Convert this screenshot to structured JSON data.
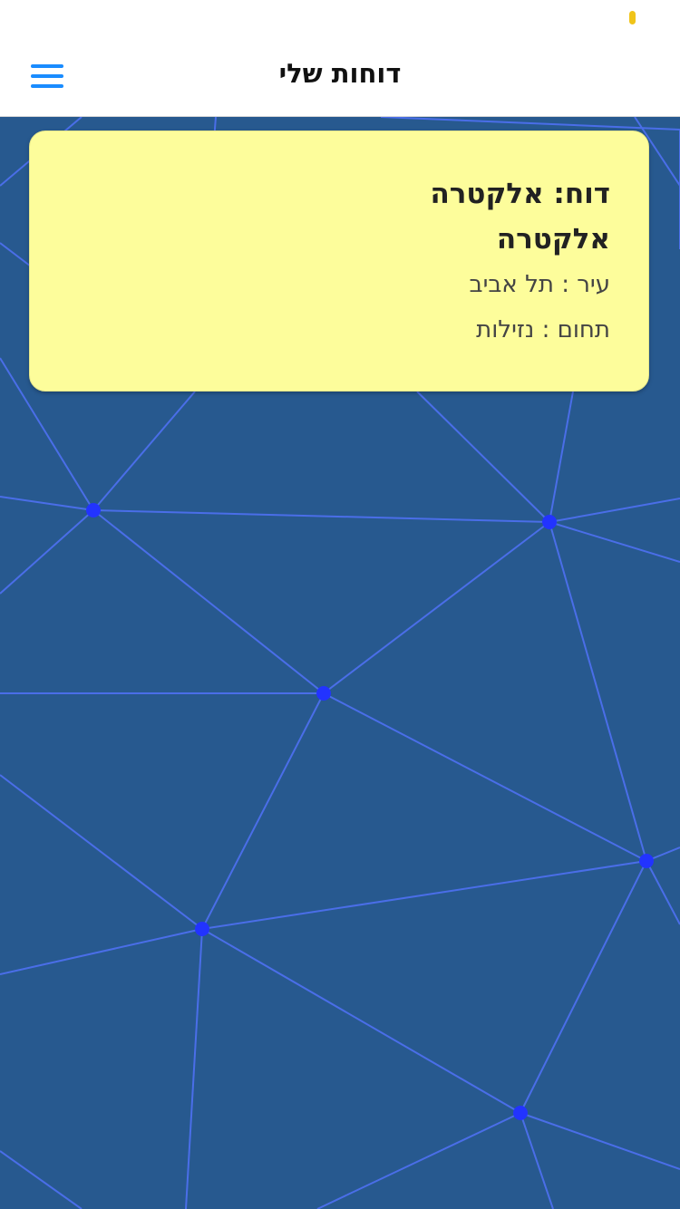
{
  "colors": {
    "background": "#27598f",
    "network_line": "#4a6ee8",
    "network_node": "#2233ff",
    "card_background": "#fdfd9b",
    "menu_icon": "#1a8cff",
    "status_dot": "#f0c419"
  },
  "header": {
    "title": "דוחות שלי",
    "menu_icon": "hamburger-menu-icon"
  },
  "report_card": {
    "title": "דוח: אלקטרה אלקטרה",
    "city_line": "עיר : תל אביב",
    "field_line": "תחום : נזילות"
  }
}
